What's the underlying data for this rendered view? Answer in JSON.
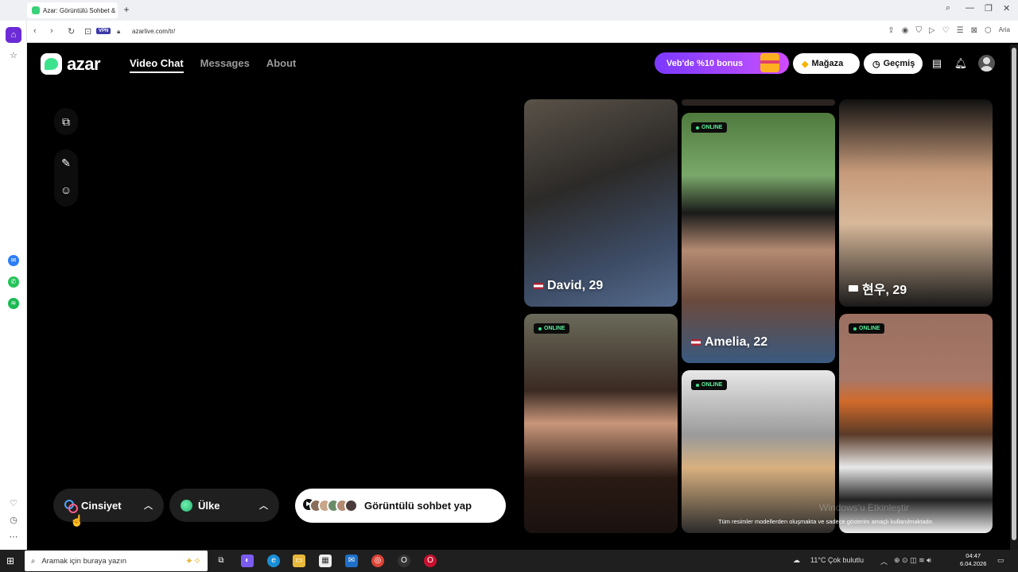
{
  "browser": {
    "tab_title": "Azar: Görüntülü Sohbet &",
    "tab_close": "×",
    "new_tab": "+",
    "vpn": "VPN",
    "url": "azarlive.com/tr/",
    "aria": "Aria"
  },
  "header": {
    "logo_text": "azar",
    "nav": [
      {
        "label": "Video Chat",
        "active": true
      },
      {
        "label": "Messages",
        "active": false
      },
      {
        "label": "About",
        "active": false
      }
    ],
    "bonus": "Veb'de %10 bonus",
    "store": "Mağaza",
    "history": "Geçmiş"
  },
  "controls": {
    "gender": "Cinsiyet",
    "country": "Ülke",
    "cta": "Görüntülü sohbet yap"
  },
  "cards": [
    {
      "name": "David, 29",
      "online": false,
      "flag": "us"
    },
    {
      "name": "Amelia, 22",
      "online": true,
      "online_label": "ONLINE",
      "flag": "us"
    },
    {
      "name": "현우, 29",
      "online": false,
      "flag": "kr"
    },
    {
      "name": "",
      "online": true,
      "online_label": "ONLINE"
    },
    {
      "name": "",
      "online": true,
      "online_label": "ONLINE"
    },
    {
      "name": "",
      "online": true,
      "online_label": "ONLINE"
    }
  ],
  "disclaimer": "Tüm resimler modellerden oluşmakta ve sadece gösterim amaçlı kullanılmaktadır.",
  "watermark": "Windows'u Etkinleştir",
  "taskbar": {
    "search_placeholder": "Aramak için buraya yazın",
    "weather": "11°C  Çok bulutlu",
    "time": "04:47",
    "date": "6.04.2026"
  },
  "colors": {
    "accent_green": "#3de38c",
    "bonus_purple": "#8a3dff",
    "opera_red": "#e0212e"
  }
}
